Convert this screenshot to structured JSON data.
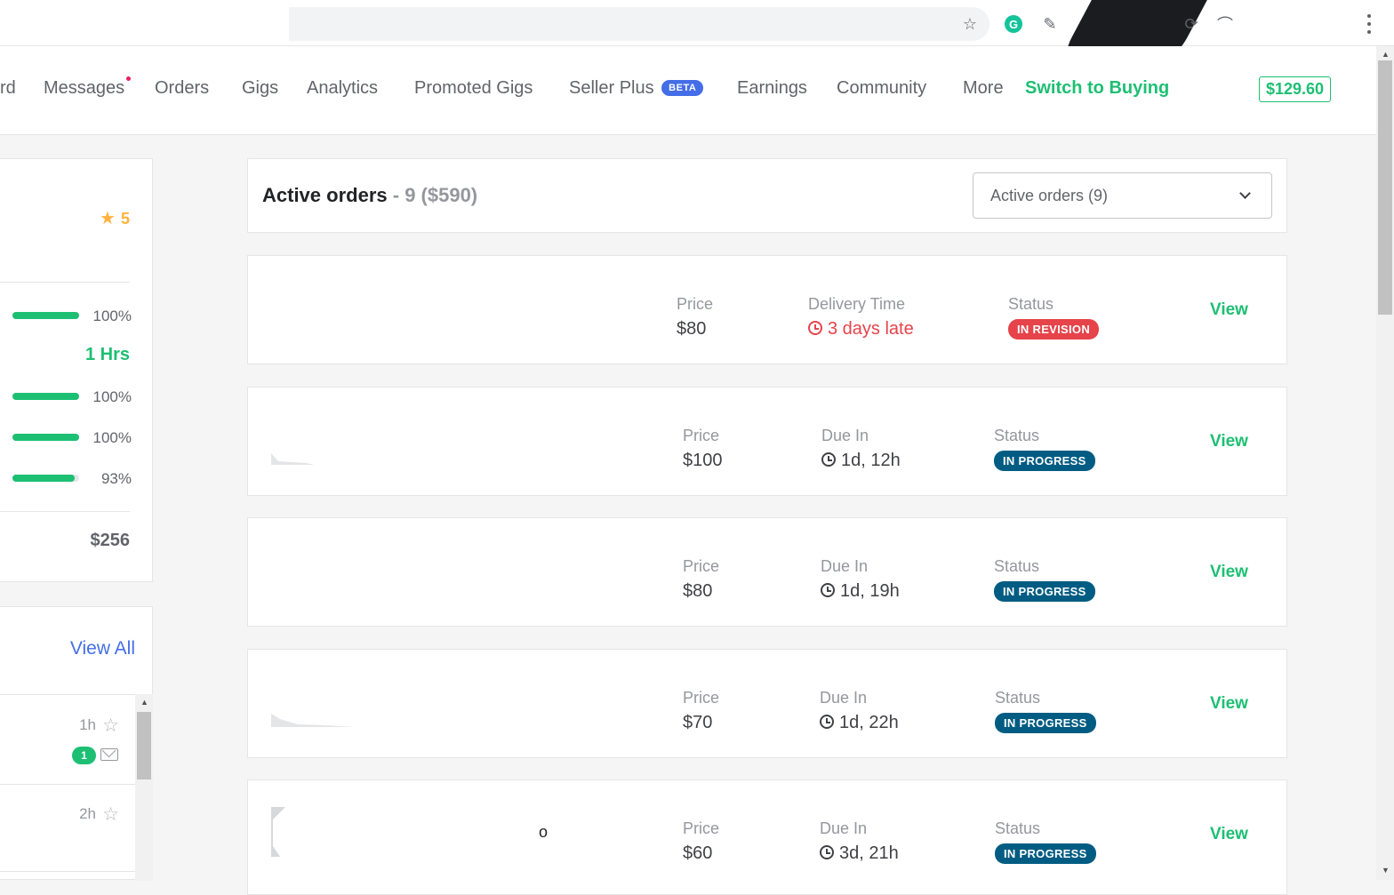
{
  "browser": {
    "bookmark_icon": "star-outline",
    "extensions": [
      "grammarly-icon",
      "eyedropper-icon",
      "refresh-icon",
      "rainbow-icon"
    ],
    "menu_icon": "kebab-menu"
  },
  "nav": {
    "items": [
      {
        "label": "rd",
        "name": "nav-dashboard"
      },
      {
        "label": "Messages",
        "name": "nav-messages",
        "has_unread_dot": true
      },
      {
        "label": "Orders",
        "name": "nav-orders"
      },
      {
        "label": "Gigs",
        "name": "nav-gigs"
      },
      {
        "label": "Analytics",
        "name": "nav-analytics"
      },
      {
        "label": "Promoted Gigs",
        "name": "nav-promoted-gigs"
      },
      {
        "label": "Seller Plus",
        "name": "nav-seller-plus",
        "badge": "BETA"
      },
      {
        "label": "Earnings",
        "name": "nav-earnings"
      },
      {
        "label": "Community",
        "name": "nav-community"
      },
      {
        "label": "More",
        "name": "nav-more"
      }
    ],
    "switch_label": "Switch to Buying",
    "balance": "$129.60",
    "colors": {
      "accent": "#1dbf73",
      "badge": "#446ee7",
      "dot": "#e91e63"
    }
  },
  "stats": {
    "rating": "5",
    "rows": [
      {
        "value": "100%",
        "fill": 1.0
      },
      {
        "value": "100%",
        "fill": 1.0
      },
      {
        "value": "100%",
        "fill": 1.0
      },
      {
        "value": "93%",
        "fill": 0.93
      }
    ],
    "response_time": "1 Hrs",
    "earned": "$256"
  },
  "inbox": {
    "view_all": "View All",
    "rows": [
      {
        "time": "1h",
        "unread": "1"
      },
      {
        "time": "2h"
      }
    ]
  },
  "orders": {
    "title": "Active orders",
    "meta": "- 9 ($590)",
    "select_value": "Active orders (9)",
    "labels": {
      "price": "Price",
      "status": "Status",
      "view": "View"
    },
    "list": [
      {
        "price": "$80",
        "time_label": "Delivery Time",
        "time_value": "3 days late",
        "late": true,
        "status": "IN REVISION",
        "status_color": "#e6434a"
      },
      {
        "price": "$100",
        "time_label": "Due In",
        "time_value": "1d, 12h",
        "late": false,
        "status": "IN PROGRESS",
        "status_color": "#005c82"
      },
      {
        "price": "$80",
        "time_label": "Due In",
        "time_value": "1d, 19h",
        "late": false,
        "status": "IN PROGRESS",
        "status_color": "#005c82"
      },
      {
        "price": "$70",
        "time_label": "Due In",
        "time_value": "1d, 22h",
        "late": false,
        "status": "IN PROGRESS",
        "status_color": "#005c82"
      },
      {
        "price": "$60",
        "time_label": "Due In",
        "time_value": "3d, 21h",
        "late": false,
        "status": "IN PROGRESS",
        "status_color": "#005c82",
        "title_fragment": "o"
      }
    ]
  }
}
